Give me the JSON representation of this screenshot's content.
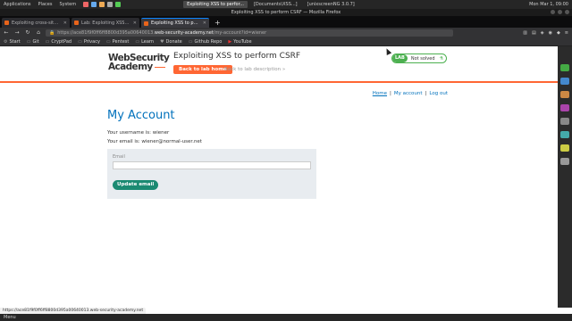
{
  "os_panel": {
    "menus": [
      "Applications",
      "Places",
      "System"
    ],
    "windows": [
      "Exploiting XSS to perfor...",
      "[Documents\\XSS...]",
      "[unixscreenNG 3.0.7]"
    ],
    "clock": "Mon Mar 1, 09:00"
  },
  "browser": {
    "window_title": "Exploiting XSS to perform CSRF — Mozilla Firefox",
    "tabs": [
      {
        "label": "Exploiting cross-site scri"
      },
      {
        "label": "Lab: Exploiting XSS to pe"
      },
      {
        "label": "Exploiting XSS to perfor"
      }
    ],
    "url_prefix": "https://ace81f9f0ff6ff8800d395a00640013.",
    "url_host": "web-security-academy.net",
    "url_suffix": "/my-account?id=wiener",
    "bookmarks": [
      "Start",
      "Git",
      "CryptPad",
      "Privacy",
      "Pentest",
      "Learn",
      "Donate",
      "Github Repo",
      "YouTube"
    ],
    "status_url": "https://ace81f9f0ff6ff8800d395a00640013.web-security-academy.net"
  },
  "header": {
    "logo_line1": "WebSecurity",
    "logo_line2": "Academy",
    "lab_title": "Exploiting XSS to perform CSRF",
    "back_button": "Back to lab home",
    "back_description": "Back to lab description »",
    "lab_badge": "LAB",
    "lab_status": "Not solved"
  },
  "nav": {
    "home": "Home",
    "my_account": "My account",
    "logout": "Log out",
    "separator": "|"
  },
  "main": {
    "heading": "My Account",
    "username_line": "Your username is: wiener",
    "email_line": "Your email is: wiener@normal-user.net",
    "email_label": "Email",
    "email_value": "",
    "update_button": "Update email"
  },
  "os_bottom": {
    "menu": "Menu"
  },
  "colors": {
    "accent": "#ff6633",
    "link": "#0071bc",
    "button_green": "#1b8a72",
    "lab_green": "#4cb050"
  }
}
